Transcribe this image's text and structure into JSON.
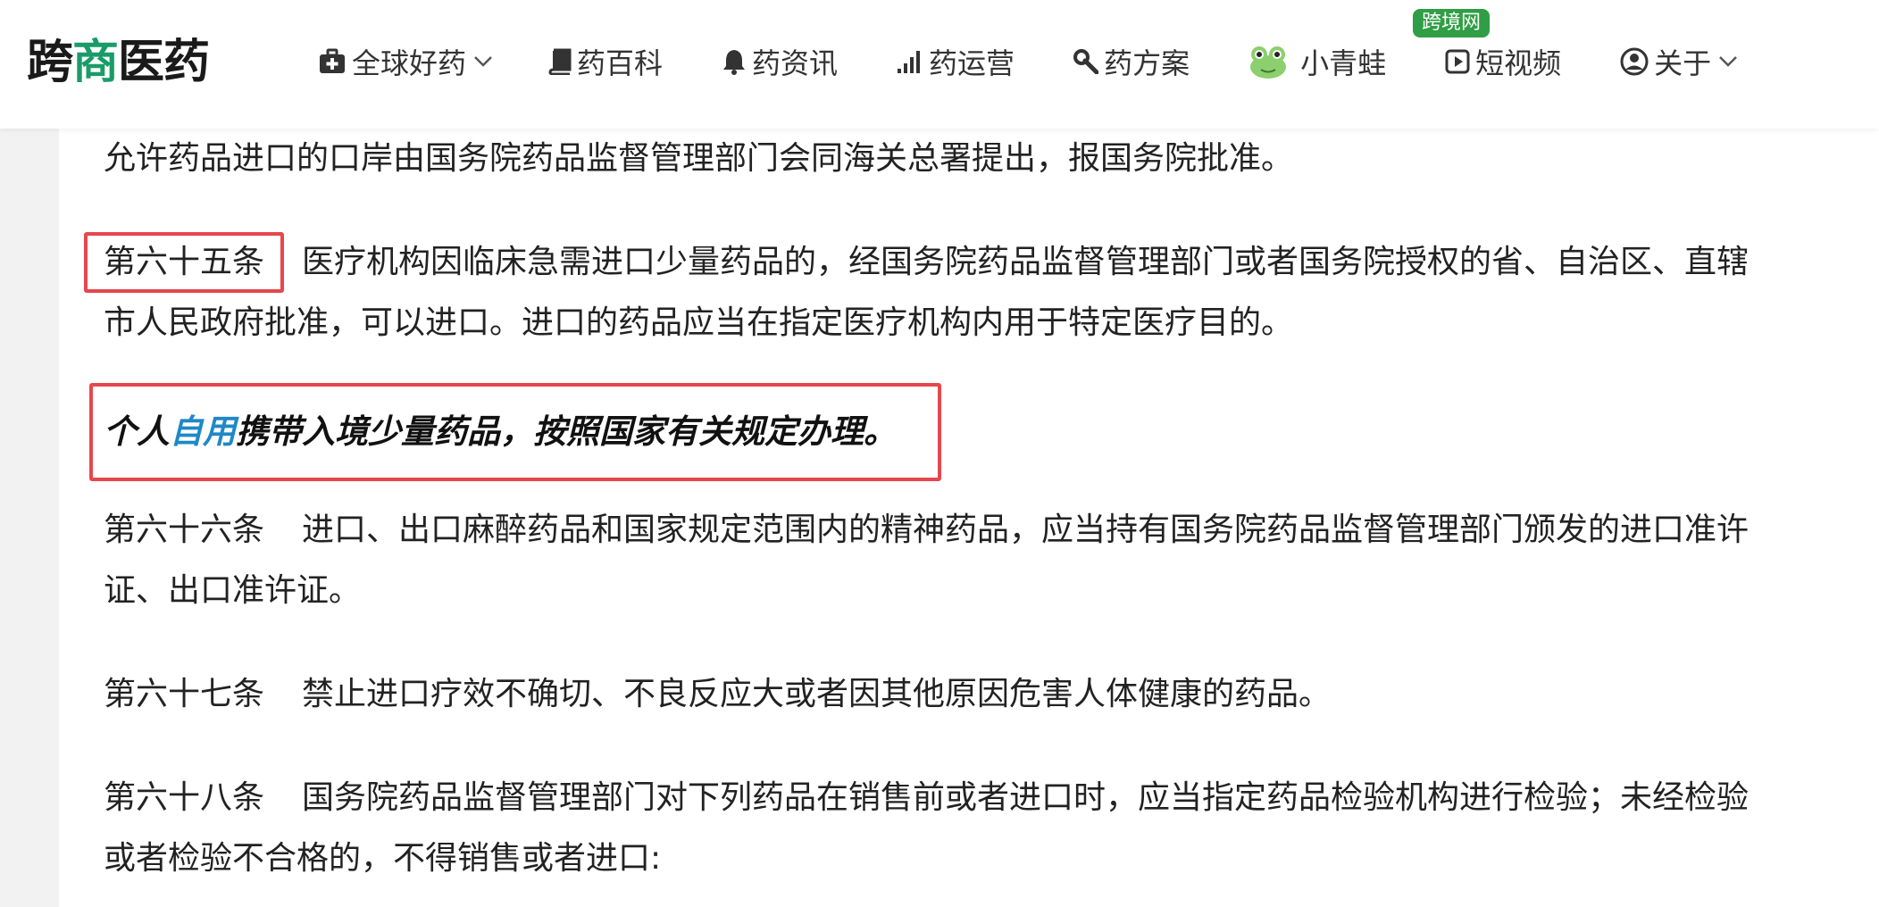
{
  "header": {
    "logo": {
      "part1": "跨",
      "accent": "商",
      "part2": "医药"
    },
    "nav": [
      {
        "label": "全球好药",
        "icon": "medkit-icon",
        "dropdown": true
      },
      {
        "label": "药百科",
        "icon": "book-icon"
      },
      {
        "label": "药资讯",
        "icon": "bell-icon"
      },
      {
        "label": "药运营",
        "icon": "signal-bars-icon"
      },
      {
        "label": "药方案",
        "icon": "wrench-icon"
      },
      {
        "label": "小青蛙",
        "icon": "frog-avatar-icon",
        "badge": "跨境网"
      },
      {
        "label": "短视频",
        "icon": "play-square-icon"
      },
      {
        "label": "关于",
        "icon": "user-circle-icon",
        "dropdown": true
      }
    ]
  },
  "article": {
    "p0": "允许药品进口的口岸由国务院药品监督管理部门会同海关总署提出，报国务院批准。",
    "p65_label": "第六十五条",
    "p65_line1": "医疗机构因临床急需进口少量药品的，经国务院药品监督管理部门或者国务院授权的省、自治区、直辖",
    "p65_line2": "市人民政府批准，可以进口。进口的药品应当在指定医疗机构内用于特定医疗目的。",
    "personal_pre": "个人",
    "personal_link": "自用",
    "personal_post": "携带入境少量药品，按照国家有关规定办理。",
    "p66_label": "第六十六条",
    "p66_line1": "进口、出口麻醉药品和国家规定范围内的精神药品，应当持有国务院药品监督管理部门颁发的进口准许",
    "p66_line2": "证、出口准许证。",
    "p67_label": "第六十七条",
    "p67_text": "禁止进口疗效不确切、不良反应大或者因其他原因危害人体健康的药品。",
    "p68_label": "第六十八条",
    "p68_line1": "国务院药品监督管理部门对下列药品在销售前或者进口时，应当指定药品检验机构进行检验；未经检验",
    "p68_line2": "或者检验不合格的，不得销售或者进口:"
  },
  "colors": {
    "highlight": "#e5474d",
    "link": "#1e88c8",
    "badge": "#2f9e44"
  }
}
